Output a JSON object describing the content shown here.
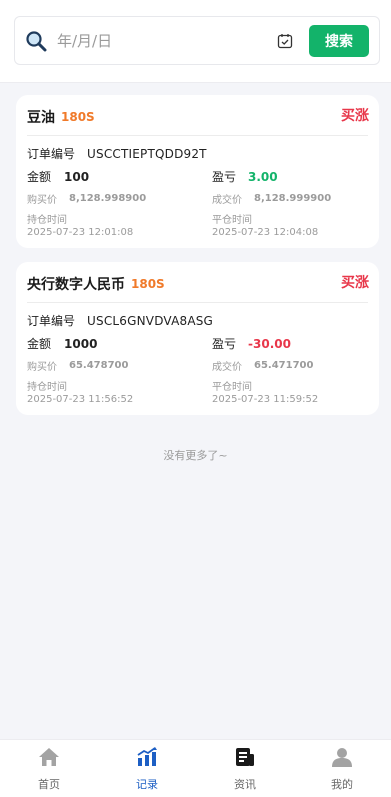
{
  "search": {
    "placeholder": "年/月/日",
    "button_label": "搜索"
  },
  "orders": [
    {
      "name": "豆油",
      "period": "180S",
      "direction": "买涨",
      "order_label": "订单编号",
      "order_no": "USCCTIEPTQDD92T",
      "amount_label": "金额",
      "amount": "100",
      "pnl_label": "盈亏",
      "pnl": "3.00",
      "buy_label": "购买价",
      "buy_price": "8,128.998900",
      "deal_label": "成交价",
      "deal_price": "8,128.999900",
      "open_label": "持仓时间",
      "open_time": "2025-07-23 12:01:08",
      "close_label": "平仓时间",
      "close_time": "2025-07-23 12:04:08"
    },
    {
      "name": "央行数字人民币",
      "period": "180S",
      "direction": "买涨",
      "order_label": "订单编号",
      "order_no": "USCL6GNVDVA8ASG",
      "amount_label": "金额",
      "amount": "1000",
      "pnl_label": "盈亏",
      "pnl": "-30.00",
      "buy_label": "购买价",
      "buy_price": "65.478700",
      "deal_label": "成交价",
      "deal_price": "65.471700",
      "open_label": "持仓时间",
      "open_time": "2025-07-23 11:56:52",
      "close_label": "平仓时间",
      "close_time": "2025-07-23 11:59:52"
    }
  ],
  "footer_text": "没有更多了~",
  "tabs": [
    {
      "label": "首页",
      "icon": "home-icon"
    },
    {
      "label": "记录",
      "icon": "chart-icon",
      "active": true
    },
    {
      "label": "资讯",
      "icon": "news-icon"
    },
    {
      "label": "我的",
      "icon": "user-icon"
    }
  ],
  "colors": {
    "accent": "#13b36a",
    "rise": "#e8374a",
    "period": "#f07a2a",
    "tab_active": "#1d5fc4"
  }
}
